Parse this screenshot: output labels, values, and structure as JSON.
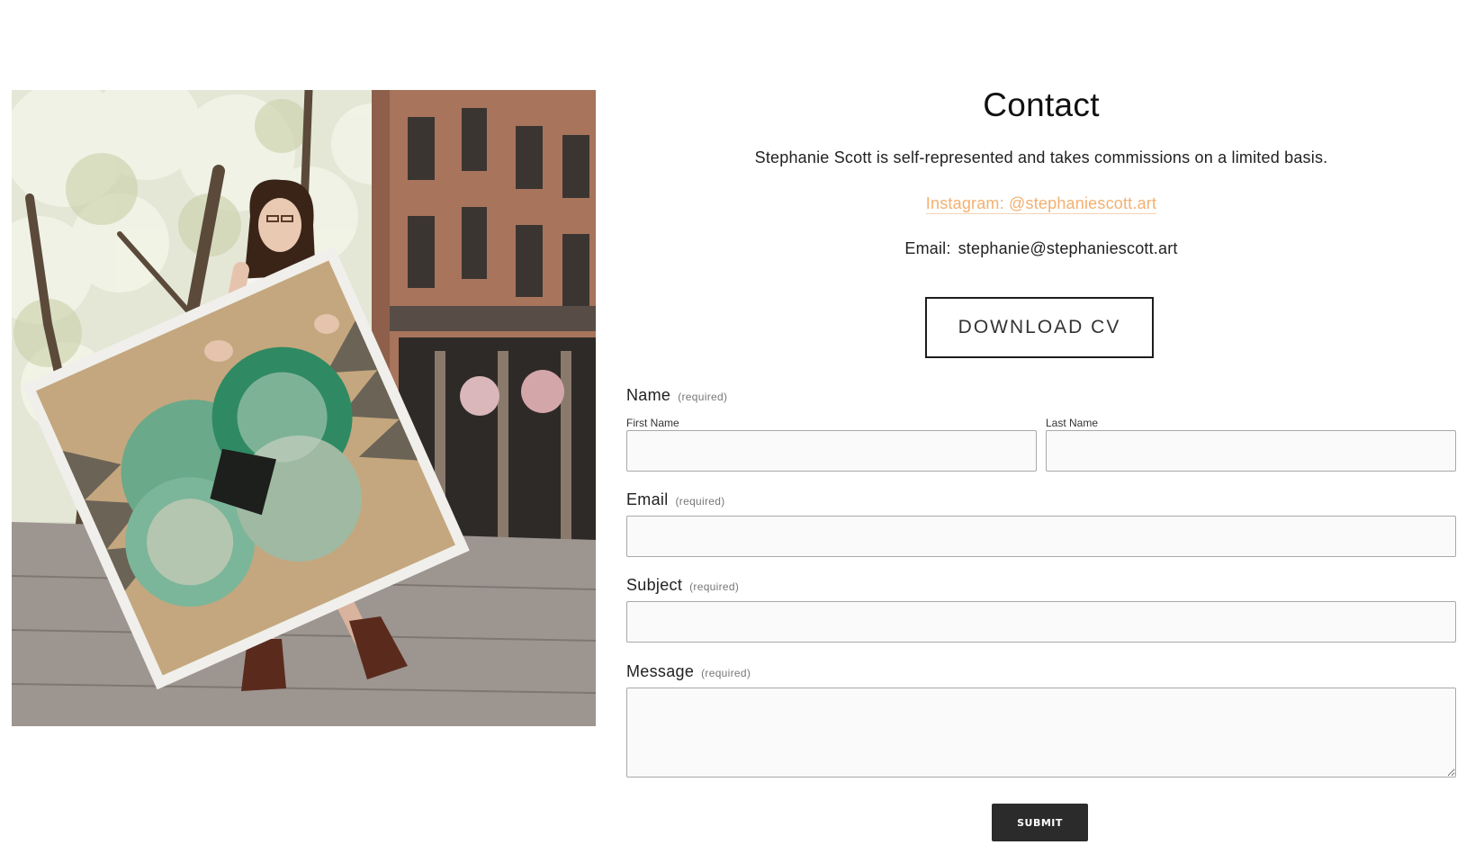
{
  "photo": {
    "alt": "Artist holding a large geometric painting on a tree-lined street"
  },
  "contact": {
    "title": "Contact",
    "intro": "Stephanie Scott is self-represented and takes commissions on a limited basis.",
    "instagram_label": "Instagram: @stephaniescott.art",
    "email_prefix": "Email:",
    "email_address": "stephanie@stephaniescott.art",
    "cv_button": "DOWNLOAD CV",
    "accent_color": "#f2b071"
  },
  "form": {
    "required_note": "(required)",
    "name_label": "Name",
    "first_name_label": "First Name",
    "last_name_label": "Last Name",
    "email_label": "Email",
    "subject_label": "Subject",
    "message_label": "Message",
    "first_name_value": "",
    "last_name_value": "",
    "email_value": "",
    "subject_value": "",
    "message_value": "",
    "submit_label": "SUBMIT"
  }
}
